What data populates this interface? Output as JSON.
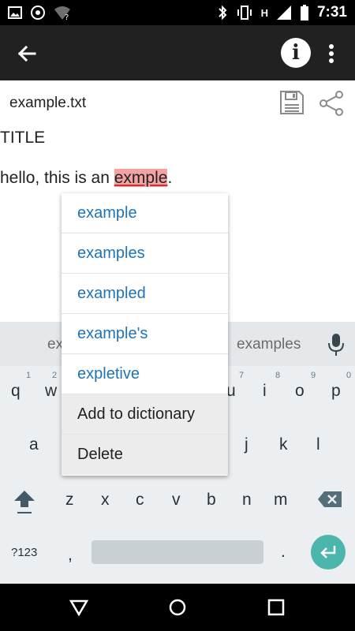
{
  "status_bar": {
    "time": "7:31",
    "network_letter": "H",
    "icons": [
      "image-icon",
      "sync-icon",
      "wifi-question-icon",
      "bluetooth-icon",
      "vibrate-icon",
      "signal-icon",
      "battery-icon"
    ]
  },
  "app_bar": {
    "back_icon": "arrow-left-icon",
    "info_label": "i",
    "more_icon": "more-vertical-icon"
  },
  "file": {
    "name": "example.txt",
    "save_icon": "floppy-icon",
    "share_icon": "share-icon"
  },
  "document": {
    "title": "TITLE",
    "line_prefix": "hello, this is an ",
    "misspelled_word": "exmple",
    "line_suffix": "."
  },
  "spell_popup": {
    "suggestions": [
      "example",
      "examples",
      "exampled",
      "example's",
      "expletive"
    ],
    "add_to_dictionary": "Add to dictionary",
    "delete": "Delete"
  },
  "keyboard": {
    "suggestion_left_partial": "ex",
    "suggestion_right": "examples",
    "row1": [
      "q",
      "w",
      "i",
      "o",
      "p"
    ],
    "row1_hints": [
      "1",
      "2",
      "8",
      "9",
      "0"
    ],
    "row1_hints_misc": [
      "7"
    ],
    "row1_hidden_key": "u",
    "row2": [
      "a",
      "j",
      "k",
      "l"
    ],
    "row3": [
      "z",
      "x",
      "c",
      "v",
      "b",
      "n",
      "m"
    ],
    "symbols_key": "?123",
    "comma_key": ",",
    "period_key": ".",
    "accent_color": "#4cb6ac"
  },
  "nav_bar": {
    "icons": [
      "back-triangle-icon",
      "home-circle-icon",
      "recents-square-icon"
    ]
  }
}
